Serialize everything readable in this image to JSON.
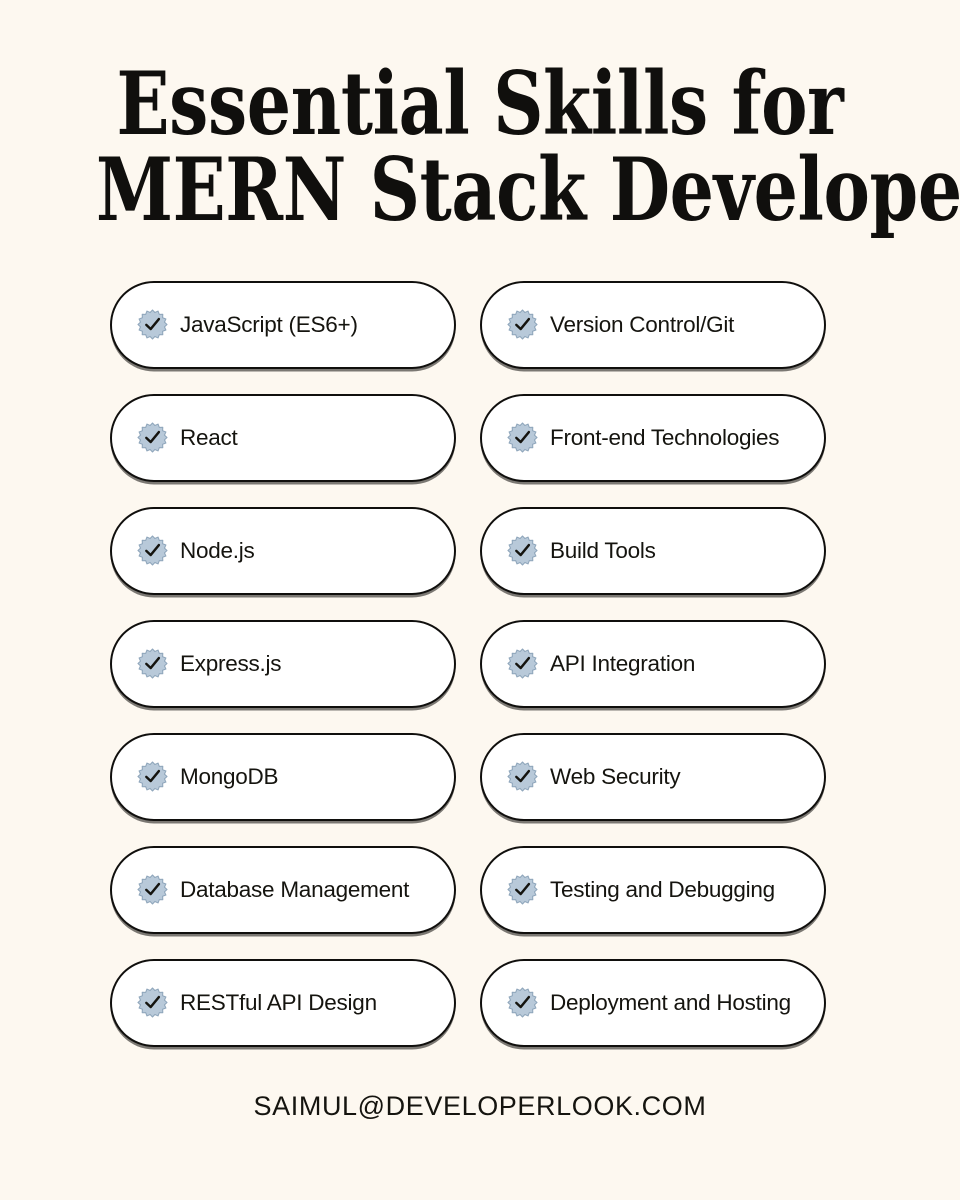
{
  "theme": {
    "background_color": "#fdf8f0",
    "pill_background": "#ffffff",
    "pill_border_color": "#100f0d",
    "text_color": "#15140f",
    "badge_fill": "#b8c9d9",
    "badge_stroke": "#8fa6bb",
    "check_color": "#15140f"
  },
  "title": {
    "line1": "Essential Skills for",
    "line2": "MERN Stack Developers"
  },
  "skills": {
    "left_column": [
      {
        "icon": "verified-check-badge-icon",
        "label": "JavaScript (ES6+)"
      },
      {
        "icon": "verified-check-badge-icon",
        "label": "React"
      },
      {
        "icon": "verified-check-badge-icon",
        "label": "Node.js"
      },
      {
        "icon": "verified-check-badge-icon",
        "label": "Express.js"
      },
      {
        "icon": "verified-check-badge-icon",
        "label": "MongoDB"
      },
      {
        "icon": "verified-check-badge-icon",
        "label": "Database Management"
      },
      {
        "icon": "verified-check-badge-icon",
        "label": "RESTful API Design"
      }
    ],
    "right_column": [
      {
        "icon": "verified-check-badge-icon",
        "label": "Version Control/Git"
      },
      {
        "icon": "verified-check-badge-icon",
        "label": "Front-end Technologies"
      },
      {
        "icon": "verified-check-badge-icon",
        "label": "Build Tools"
      },
      {
        "icon": "verified-check-badge-icon",
        "label": "API Integration"
      },
      {
        "icon": "verified-check-badge-icon",
        "label": "Web Security"
      },
      {
        "icon": "verified-check-badge-icon",
        "label": "Testing and Debugging"
      },
      {
        "icon": "verified-check-badge-icon",
        "label": "Deployment and Hosting"
      }
    ]
  },
  "footer": {
    "contact": "SAIMUL@DEVELOPERLOOK.COM"
  }
}
